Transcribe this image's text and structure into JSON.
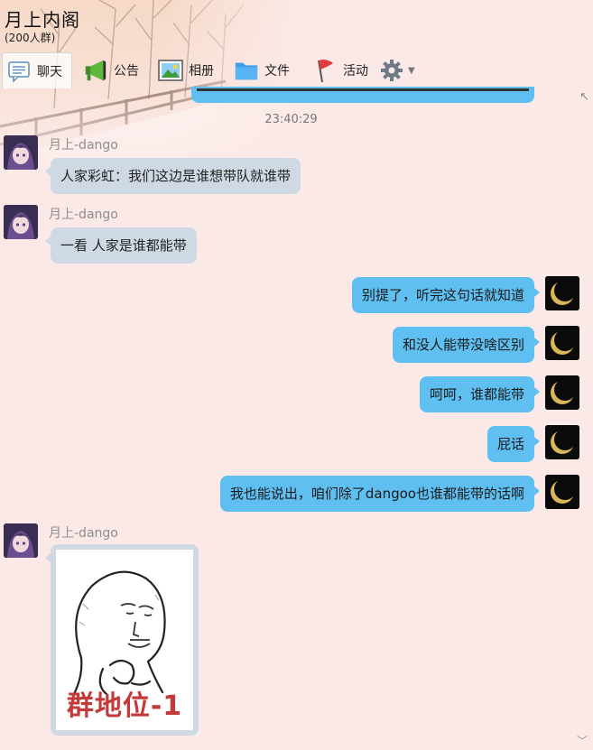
{
  "group": {
    "name": "月上内阁",
    "member_count": "(200人群)"
  },
  "toolbar": [
    {
      "id": "chat",
      "label": "聊天",
      "icon": "chat-icon",
      "active": true
    },
    {
      "id": "notice",
      "label": "公告",
      "icon": "announcement-icon",
      "active": false
    },
    {
      "id": "album",
      "label": "相册",
      "icon": "album-icon",
      "active": false
    },
    {
      "id": "files",
      "label": "文件",
      "icon": "folder-icon",
      "active": false
    },
    {
      "id": "activity",
      "label": "活动",
      "icon": "flag-icon",
      "active": false
    },
    {
      "id": "settings",
      "label": "",
      "icon": "gear-icon",
      "active": false
    }
  ],
  "chat": {
    "timestamp": "23:40:29",
    "messages": [
      {
        "dir": "in",
        "sender": "月上-dango",
        "text": "人家彩虹：我们这边是谁想带队就谁带"
      },
      {
        "dir": "in",
        "sender": "月上-dango",
        "text": "一看 人家是谁都能带"
      },
      {
        "dir": "out",
        "text": "别提了，听完这句话就知道"
      },
      {
        "dir": "out",
        "text": "和没人能带没啥区别"
      },
      {
        "dir": "out",
        "text": "呵呵，谁都能带"
      },
      {
        "dir": "out",
        "text": "屁话"
      },
      {
        "dir": "out",
        "text": "我也能说出，咱们除了dangoo也谁都能带的话啊"
      }
    ],
    "sticker": {
      "sender": "月上-dango",
      "caption": "群地位-1"
    }
  },
  "colors": {
    "background": "#fbe9e7",
    "incoming_bubble": "#cfd9e4",
    "outgoing_bubble": "#5ebff0",
    "sender_name": "#8d8d8d",
    "sticker_caption": "#c43a3a"
  }
}
